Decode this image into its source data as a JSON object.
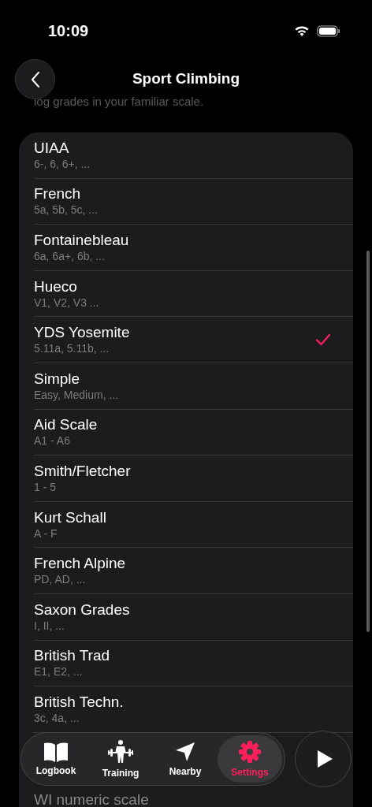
{
  "status_bar": {
    "time": "10:09"
  },
  "header": {
    "title": "Sport Climbing"
  },
  "background_text": "log grades in your familiar scale.",
  "scales": [
    {
      "name": "UIAA",
      "example": "6-, 6, 6+, ...",
      "selected": false
    },
    {
      "name": "French",
      "example": "5a, 5b, 5c, ...",
      "selected": false
    },
    {
      "name": "Fontainebleau",
      "example": "6a, 6a+, 6b, ...",
      "selected": false
    },
    {
      "name": "Hueco",
      "example": "V1, V2, V3 ...",
      "selected": false
    },
    {
      "name": "YDS Yosemite",
      "example": "5.11a, 5.11b, ...",
      "selected": true
    },
    {
      "name": "Simple",
      "example": "Easy, Medium, ...",
      "selected": false
    },
    {
      "name": "Aid Scale",
      "example": "A1 - A6",
      "selected": false
    },
    {
      "name": "Smith/Fletcher",
      "example": "1 - 5",
      "selected": false
    },
    {
      "name": "Kurt Schall",
      "example": "A - F",
      "selected": false
    },
    {
      "name": "French Alpine",
      "example": "PD, AD, ...",
      "selected": false
    },
    {
      "name": "Saxon Grades",
      "example": "I, II, ...",
      "selected": false
    },
    {
      "name": "British Trad",
      "example": "E1, E2, ...",
      "selected": false
    },
    {
      "name": "British Techn.",
      "example": "3c, 4a, ...",
      "selected": false
    },
    {
      "name": "WI numeric scale",
      "selected": false
    }
  ],
  "tabs": [
    {
      "label": "Logbook",
      "selected": false
    },
    {
      "label": "Training",
      "selected": false
    },
    {
      "label": "Nearby",
      "selected": false
    },
    {
      "label": "Settings",
      "selected": true
    }
  ]
}
